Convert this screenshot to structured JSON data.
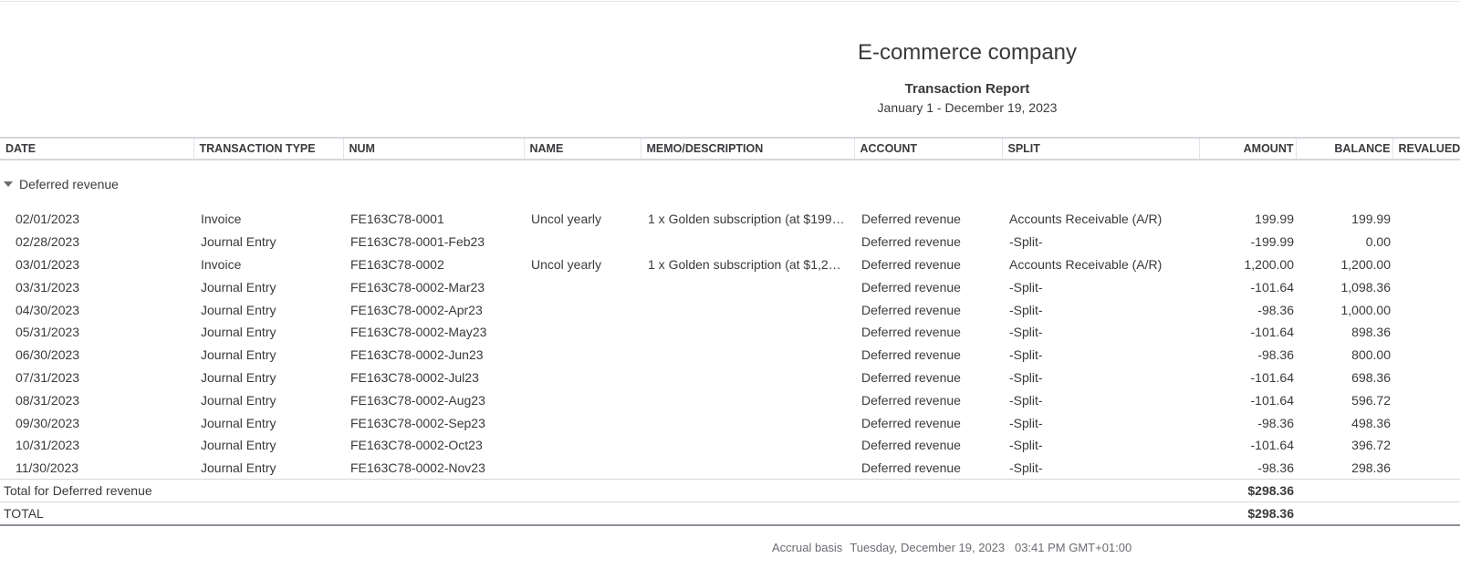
{
  "header": {
    "company": "E-commerce company",
    "report_title": "Transaction Report",
    "date_range": "January 1 - December 19, 2023"
  },
  "columns": {
    "date": "DATE",
    "transaction_type": "TRANSACTION TYPE",
    "num": "NUM",
    "name": "NAME",
    "memo": "MEMO/DESCRIPTION",
    "account": "ACCOUNT",
    "split": "SPLIT",
    "amount": "AMOUNT",
    "balance": "BALANCE",
    "revalued": "REVALUED"
  },
  "group": {
    "label": "Deferred revenue",
    "rows": [
      {
        "date": "02/01/2023",
        "type": "Invoice",
        "num": "FE163C78-0001",
        "name": "Uncol yearly",
        "memo": "1 x Golden subscription (at $199…",
        "account": "Deferred revenue",
        "split": "Accounts Receivable (A/R)",
        "amount": "199.99",
        "balance": "199.99"
      },
      {
        "date": "02/28/2023",
        "type": "Journal Entry",
        "num": "FE163C78-0001-Feb23",
        "name": "",
        "memo": "",
        "account": "Deferred revenue",
        "split": "-Split-",
        "amount": "-199.99",
        "balance": "0.00"
      },
      {
        "date": "03/01/2023",
        "type": "Invoice",
        "num": "FE163C78-0002",
        "name": "Uncol yearly",
        "memo": "1 x Golden subscription (at $1,2…",
        "account": "Deferred revenue",
        "split": "Accounts Receivable (A/R)",
        "amount": "1,200.00",
        "balance": "1,200.00"
      },
      {
        "date": "03/31/2023",
        "type": "Journal Entry",
        "num": "FE163C78-0002-Mar23",
        "name": "",
        "memo": "",
        "account": "Deferred revenue",
        "split": "-Split-",
        "amount": "-101.64",
        "balance": "1,098.36"
      },
      {
        "date": "04/30/2023",
        "type": "Journal Entry",
        "num": "FE163C78-0002-Apr23",
        "name": "",
        "memo": "",
        "account": "Deferred revenue",
        "split": "-Split-",
        "amount": "-98.36",
        "balance": "1,000.00"
      },
      {
        "date": "05/31/2023",
        "type": "Journal Entry",
        "num": "FE163C78-0002-May23",
        "name": "",
        "memo": "",
        "account": "Deferred revenue",
        "split": "-Split-",
        "amount": "-101.64",
        "balance": "898.36"
      },
      {
        "date": "06/30/2023",
        "type": "Journal Entry",
        "num": "FE163C78-0002-Jun23",
        "name": "",
        "memo": "",
        "account": "Deferred revenue",
        "split": "-Split-",
        "amount": "-98.36",
        "balance": "800.00"
      },
      {
        "date": "07/31/2023",
        "type": "Journal Entry",
        "num": "FE163C78-0002-Jul23",
        "name": "",
        "memo": "",
        "account": "Deferred revenue",
        "split": "-Split-",
        "amount": "-101.64",
        "balance": "698.36"
      },
      {
        "date": "08/31/2023",
        "type": "Journal Entry",
        "num": "FE163C78-0002-Aug23",
        "name": "",
        "memo": "",
        "account": "Deferred revenue",
        "split": "-Split-",
        "amount": "-101.64",
        "balance": "596.72"
      },
      {
        "date": "09/30/2023",
        "type": "Journal Entry",
        "num": "FE163C78-0002-Sep23",
        "name": "",
        "memo": "",
        "account": "Deferred revenue",
        "split": "-Split-",
        "amount": "-98.36",
        "balance": "498.36"
      },
      {
        "date": "10/31/2023",
        "type": "Journal Entry",
        "num": "FE163C78-0002-Oct23",
        "name": "",
        "memo": "",
        "account": "Deferred revenue",
        "split": "-Split-",
        "amount": "-101.64",
        "balance": "396.72"
      },
      {
        "date": "11/30/2023",
        "type": "Journal Entry",
        "num": "FE163C78-0002-Nov23",
        "name": "",
        "memo": "",
        "account": "Deferred revenue",
        "split": "-Split-",
        "amount": "-98.36",
        "balance": "298.36"
      }
    ],
    "total_label": "Total for Deferred revenue",
    "total_amount": "$298.36"
  },
  "grand_total": {
    "label": "TOTAL",
    "amount": "$298.36"
  },
  "footer": {
    "basis": "Accrual basis",
    "timestamp": "Tuesday, December 19, 2023   03:41 PM GMT+01:00"
  },
  "colors": {
    "text": "#393a3d",
    "muted": "#6b6c72",
    "rule": "#d4d7dc"
  }
}
